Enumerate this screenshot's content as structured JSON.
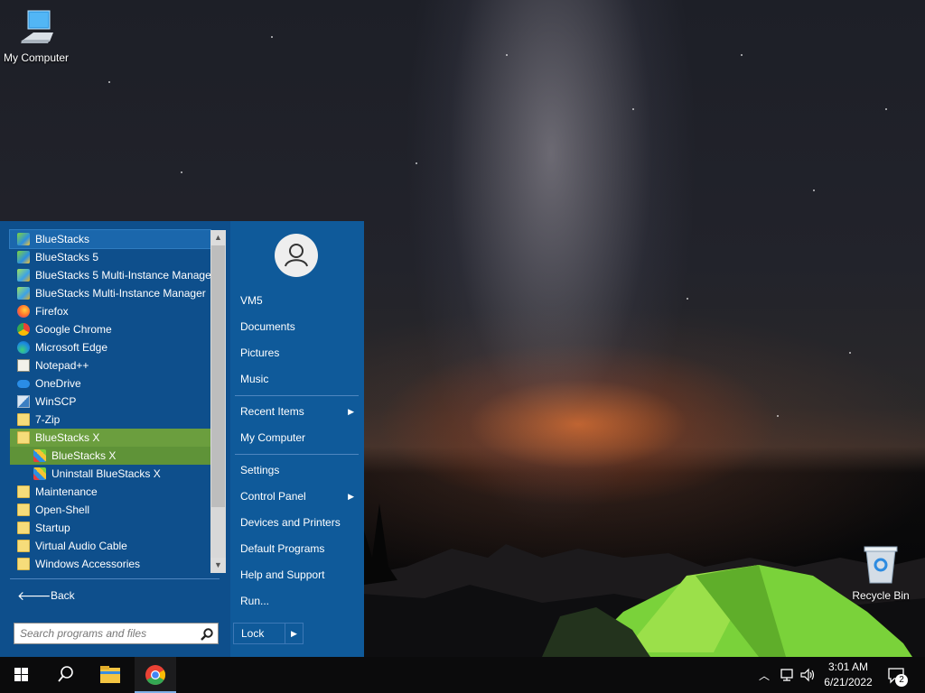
{
  "desktop": {
    "icons": [
      {
        "label": "My Computer",
        "icon": "computer-icon"
      },
      {
        "label": "Recycle Bin",
        "icon": "recycle-bin-icon"
      }
    ]
  },
  "start_menu": {
    "programs": [
      {
        "label": "BlueStacks",
        "icon": "bluestacks-icon"
      },
      {
        "label": "BlueStacks 5",
        "icon": "bluestacks5-icon"
      },
      {
        "label": "BlueStacks 5 Multi-Instance Manager",
        "icon": "bluestacks-mim-icon"
      },
      {
        "label": "BlueStacks Multi-Instance Manager",
        "icon": "bluestacks-mim-icon"
      },
      {
        "label": "Firefox",
        "icon": "firefox-icon"
      },
      {
        "label": "Google Chrome",
        "icon": "chrome-icon"
      },
      {
        "label": "Microsoft Edge",
        "icon": "edge-icon"
      },
      {
        "label": "Notepad++",
        "icon": "notepadpp-icon"
      },
      {
        "label": "OneDrive",
        "icon": "onedrive-icon"
      },
      {
        "label": "WinSCP",
        "icon": "winscp-icon"
      },
      {
        "label": "7-Zip",
        "icon": "folder-icon"
      },
      {
        "label": "BlueStacks X",
        "icon": "folder-icon"
      },
      {
        "label": "BlueStacks X",
        "icon": "bluestacks-x-icon"
      },
      {
        "label": "Uninstall BlueStacks X",
        "icon": "uninstall-icon"
      },
      {
        "label": "Maintenance",
        "icon": "folder-icon"
      },
      {
        "label": "Open-Shell",
        "icon": "folder-icon"
      },
      {
        "label": "Startup",
        "icon": "folder-icon"
      },
      {
        "label": "Virtual Audio Cable",
        "icon": "folder-icon"
      },
      {
        "label": "Windows Accessories",
        "icon": "folder-icon"
      }
    ],
    "back_label": "Back",
    "search_placeholder": "Search programs and files",
    "places": [
      {
        "label": "VM5"
      },
      {
        "label": "Documents"
      },
      {
        "label": "Pictures"
      },
      {
        "label": "Music"
      },
      {
        "label": "Recent Items",
        "submenu": true
      },
      {
        "label": "My Computer"
      },
      {
        "label": "Settings"
      },
      {
        "label": "Control Panel",
        "submenu": true
      },
      {
        "label": "Devices and Printers"
      },
      {
        "label": "Default Programs"
      },
      {
        "label": "Help and Support"
      },
      {
        "label": "Run..."
      }
    ],
    "lock_label": "Lock"
  },
  "taskbar": {
    "apps": [
      "start-button",
      "search-button",
      "file-explorer",
      "google-chrome"
    ],
    "time": "3:01 AM",
    "date": "6/21/2022",
    "notification_count": "2"
  },
  "colors": {
    "start_menu_bg": "#0f5a9a",
    "selected_item": "#6b9e3e",
    "taskbar": "#0b0b0c"
  }
}
